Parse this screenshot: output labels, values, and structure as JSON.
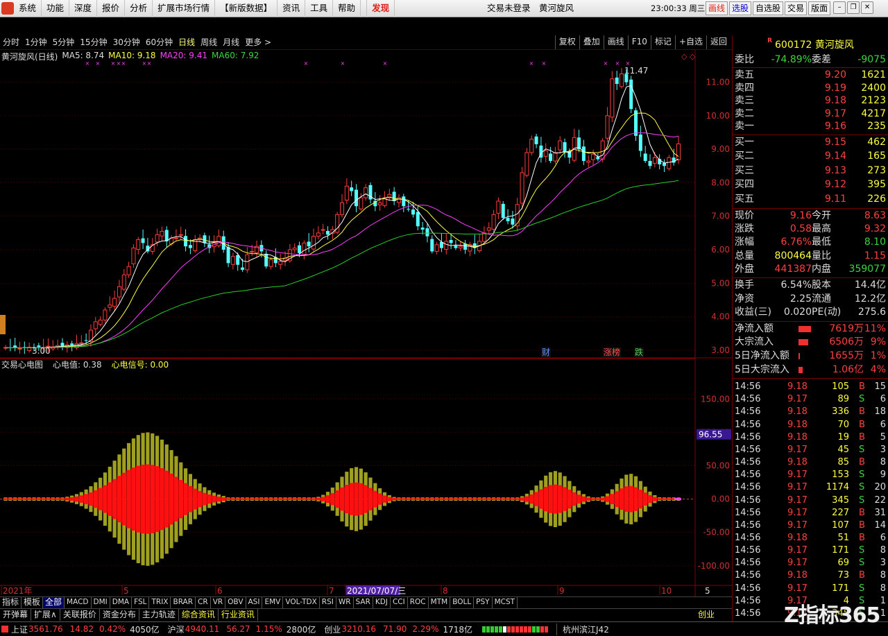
{
  "menu": {
    "items": [
      "系统",
      "功能",
      "深度",
      "报价",
      "分析",
      "扩展市场行情",
      "【新版数据】",
      "资讯",
      "工具",
      "帮助"
    ],
    "faxian": "发现",
    "center_title": "交易未登录　黄河旋风",
    "clock": "23:00:33 周三",
    "right_buttons": [
      "画线",
      "选股",
      "自选股",
      "交易",
      "版面"
    ]
  },
  "period_tabs": {
    "items": [
      "分时",
      "1分钟",
      "5分钟",
      "15分钟",
      "30分钟",
      "60分钟",
      "日线",
      "周线",
      "月线",
      "更多 >"
    ],
    "active": "日线",
    "right": [
      "复权",
      "叠加",
      "画线",
      "F10",
      "标记",
      "+自选",
      "返回"
    ]
  },
  "stock_header": {
    "name": "黄河旋风(日线)",
    "ma5": "MA5: 8.74",
    "ma10": "MA10: 9.18",
    "ma20": "MA20: 9.41",
    "ma60": "MA60: 7.92"
  },
  "sub_header": {
    "name": "交易心电图",
    "v1": "心电值: 0.38",
    "v2": "心电信号: 0.00"
  },
  "chart_data": [
    {
      "type": "candlestick",
      "title": "黄河旋风(日线)",
      "y_axis_labels": [
        "11.00",
        "10.00",
        "9.00",
        "8.00",
        "7.00",
        "6.00",
        "5.00",
        "4.00",
        "3.00"
      ],
      "ylim": [
        2.75,
        11.55
      ],
      "x_axis_labels": [
        "2021年",
        "5",
        "6",
        "7",
        "2021/07/07/三",
        "8",
        "9",
        "10"
      ],
      "annotations": {
        "high": "11.47",
        "low": "3.00",
        "events": [
          "财",
          "涨榜",
          "跌"
        ]
      },
      "colors": {
        "up": "#ff3c3c",
        "down": "#54ffff",
        "ma5": "#ffffff",
        "ma10": "#ffff3c",
        "ma20": "#ff40ff",
        "ma60": "#28d028"
      },
      "close": [
        3.08,
        3.06,
        3.09,
        3.05,
        3.07,
        3.09,
        3.06,
        3.1,
        3.08,
        3.12,
        3.1,
        3.14,
        3.12,
        3.16,
        3.15,
        3.2,
        3.22,
        3.3,
        3.6,
        3.85,
        3.9,
        4.2,
        4.35,
        4.55,
        4.9,
        5.25,
        5.5,
        6.05,
        6.3,
        6.2,
        5.95,
        6.15,
        6.45,
        6.55,
        6.25,
        6.35,
        6.35,
        6.45,
        6.1,
        6.05,
        6.3,
        6.35,
        6.2,
        6.05,
        6.2,
        6.4,
        6.0,
        5.6,
        5.8,
        5.55,
        5.4,
        5.85,
        5.95,
        6.1,
        5.95,
        5.5,
        5.7,
        5.6,
        5.65,
        5.75,
        6.0,
        6.05,
        5.9,
        6.2,
        6.1,
        6.4,
        6.5,
        6.6,
        6.45,
        6.6,
        7.05,
        7.4,
        7.9,
        7.75,
        7.3,
        7.55,
        7.85,
        7.5,
        7.3,
        7.4,
        7.55,
        7.65,
        7.45,
        7.55,
        7.3,
        7.2,
        7.05,
        6.7,
        6.6,
        6.4,
        5.95,
        6.15,
        6.05,
        6.25,
        6.2,
        6.05,
        6.1,
        6.0,
        6.15,
        6.05,
        6.25,
        6.5,
        6.65,
        7.05,
        7.45,
        6.95,
        6.85,
        6.75,
        7.35,
        8.3,
        8.9,
        9.3,
        9.15,
        8.75,
        8.95,
        8.65,
        8.9,
        9.25,
        8.9,
        8.75,
        9.35,
        9.0,
        8.65,
        8.65,
        8.85,
        8.7,
        9.25,
        10.0,
        11.1,
        10.95,
        11.25,
        11.0,
        10.2,
        9.4,
        8.95,
        8.65,
        8.5,
        8.75,
        8.55,
        8.5,
        8.75,
        8.6,
        9.16
      ],
      "series": [
        {
          "name": "MA5"
        },
        {
          "name": "MA10"
        },
        {
          "name": "MA20"
        },
        {
          "name": "MA60"
        }
      ]
    },
    {
      "type": "bar",
      "title": "交易心电图",
      "y_axis_labels": [
        "150.00",
        "100.00",
        "50.00",
        "0.00",
        "-50.00",
        "-100.00"
      ],
      "ylim": [
        -122,
        195
      ],
      "current_value": "96.55",
      "colors": {
        "inner": "#ff1010",
        "outer": "#a0a020"
      }
    }
  ],
  "right_panel": {
    "code": "600172",
    "name": "黄河旋风",
    "weibi": {
      "label": "委比",
      "value": "-74.89%",
      "label2": "委差",
      "value2": "-9075"
    },
    "asks": [
      {
        "l": "卖五",
        "p": "9.20",
        "v": "1621"
      },
      {
        "l": "卖四",
        "p": "9.19",
        "v": "2400"
      },
      {
        "l": "卖三",
        "p": "9.18",
        "v": "2123"
      },
      {
        "l": "卖二",
        "p": "9.17",
        "v": "4217"
      },
      {
        "l": "卖一",
        "p": "9.16",
        "v": "235"
      }
    ],
    "bids": [
      {
        "l": "买一",
        "p": "9.15",
        "v": "462"
      },
      {
        "l": "买二",
        "p": "9.14",
        "v": "165"
      },
      {
        "l": "买三",
        "p": "9.13",
        "v": "273"
      },
      {
        "l": "买四",
        "p": "9.12",
        "v": "395"
      },
      {
        "l": "买五",
        "p": "9.11",
        "v": "226"
      }
    ],
    "stats1": [
      [
        "现价",
        "9.16",
        "今开",
        "8.63"
      ],
      [
        "涨跌",
        "0.58",
        "最高",
        "9.32"
      ],
      [
        "涨幅",
        "6.76%",
        "最低",
        "8.10"
      ],
      [
        "总量",
        "800464",
        "量比",
        "1.15"
      ],
      [
        "外盘",
        "441387",
        "内盘",
        "359077"
      ]
    ],
    "stats2": [
      [
        "换手",
        "6.54%",
        "股本",
        "14.4亿"
      ],
      [
        "净资",
        "2.25",
        "流通",
        "12.2亿"
      ],
      [
        "收益(三)",
        "0.020",
        "PE(动)",
        "275.6"
      ]
    ],
    "flows": [
      {
        "l": "净流入额",
        "v": "7619万",
        "p": "11%",
        "w": 0.11
      },
      {
        "l": "大宗流入",
        "v": "6506万",
        "p": "9%",
        "w": 0.09
      },
      {
        "l": "5日净流入额",
        "v": "1655万",
        "p": "1%",
        "w": 0.01
      },
      {
        "l": "5日大宗流入",
        "v": "1.06亿",
        "p": "4%",
        "w": 0.04
      }
    ],
    "ticks": [
      [
        "14:56",
        "9.18",
        "105",
        "B",
        "15"
      ],
      [
        "14:56",
        "9.17",
        "89",
        "S",
        "6"
      ],
      [
        "14:56",
        "9.18",
        "336",
        "B",
        "18"
      ],
      [
        "14:56",
        "9.18",
        "70",
        "B",
        "6"
      ],
      [
        "14:56",
        "9.18",
        "19",
        "B",
        "5"
      ],
      [
        "14:56",
        "9.17",
        "45",
        "S",
        "3"
      ],
      [
        "14:56",
        "9.18",
        "85",
        "B",
        "8"
      ],
      [
        "14:56",
        "9.17",
        "153",
        "S",
        "9"
      ],
      [
        "14:56",
        "9.17",
        "1174",
        "S",
        "20"
      ],
      [
        "14:56",
        "9.17",
        "345",
        "S",
        "22"
      ],
      [
        "14:56",
        "9.17",
        "227",
        "B",
        "31"
      ],
      [
        "14:56",
        "9.17",
        "107",
        "B",
        "14"
      ],
      [
        "14:56",
        "9.18",
        "51",
        "B",
        "6"
      ],
      [
        "14:56",
        "9.17",
        "171",
        "S",
        "8"
      ],
      [
        "14:56",
        "9.17",
        "69",
        "S",
        "3"
      ],
      [
        "14:56",
        "9.18",
        "73",
        "B",
        "8"
      ],
      [
        "14:56",
        "9.17",
        "171",
        "S",
        "8"
      ],
      [
        "14:56",
        "9.17",
        "4",
        "S",
        "1"
      ],
      [
        "14:56",
        "9.17",
        "345",
        "S",
        "1"
      ]
    ]
  },
  "indicator_tabs": [
    "指标",
    "模板",
    "全部",
    "MACD",
    "DMI",
    "DMA",
    "FSL",
    "TRIX",
    "BRAR",
    "CR",
    "VR",
    "OBV",
    "ASI",
    "EMV",
    "VOL-TDX",
    "RSI",
    "WR",
    "SAR",
    "KDJ",
    "CCI",
    "ROC",
    "MTM",
    "BOLL",
    "PSY",
    "MCST"
  ],
  "bottom_tabs": [
    "开弹幕",
    "扩展∧",
    "关联报价",
    "资金分布",
    "主力轨迹",
    "综合资讯",
    "行业资讯"
  ],
  "bottom_right": "创业",
  "status": {
    "sh_label": "上证",
    "sh": "3561.76",
    "sh_chg": "14.82",
    "sh_pct": "0.42%",
    "sh_amt": "4050亿",
    "sz_label": "沪深",
    "sz": "4940.11",
    "sz_chg": "56.27",
    "sz_pct": "1.15%",
    "sz_amt": "2800亿",
    "cy_label": "创业",
    "cy": "3210.16",
    "cy_chg": "71.90",
    "cy_pct": "2.29%",
    "cy_amt": "1718亿",
    "location": "杭州滨江J42"
  },
  "brand": {
    "text": "指标365",
    "mark": "Z"
  }
}
